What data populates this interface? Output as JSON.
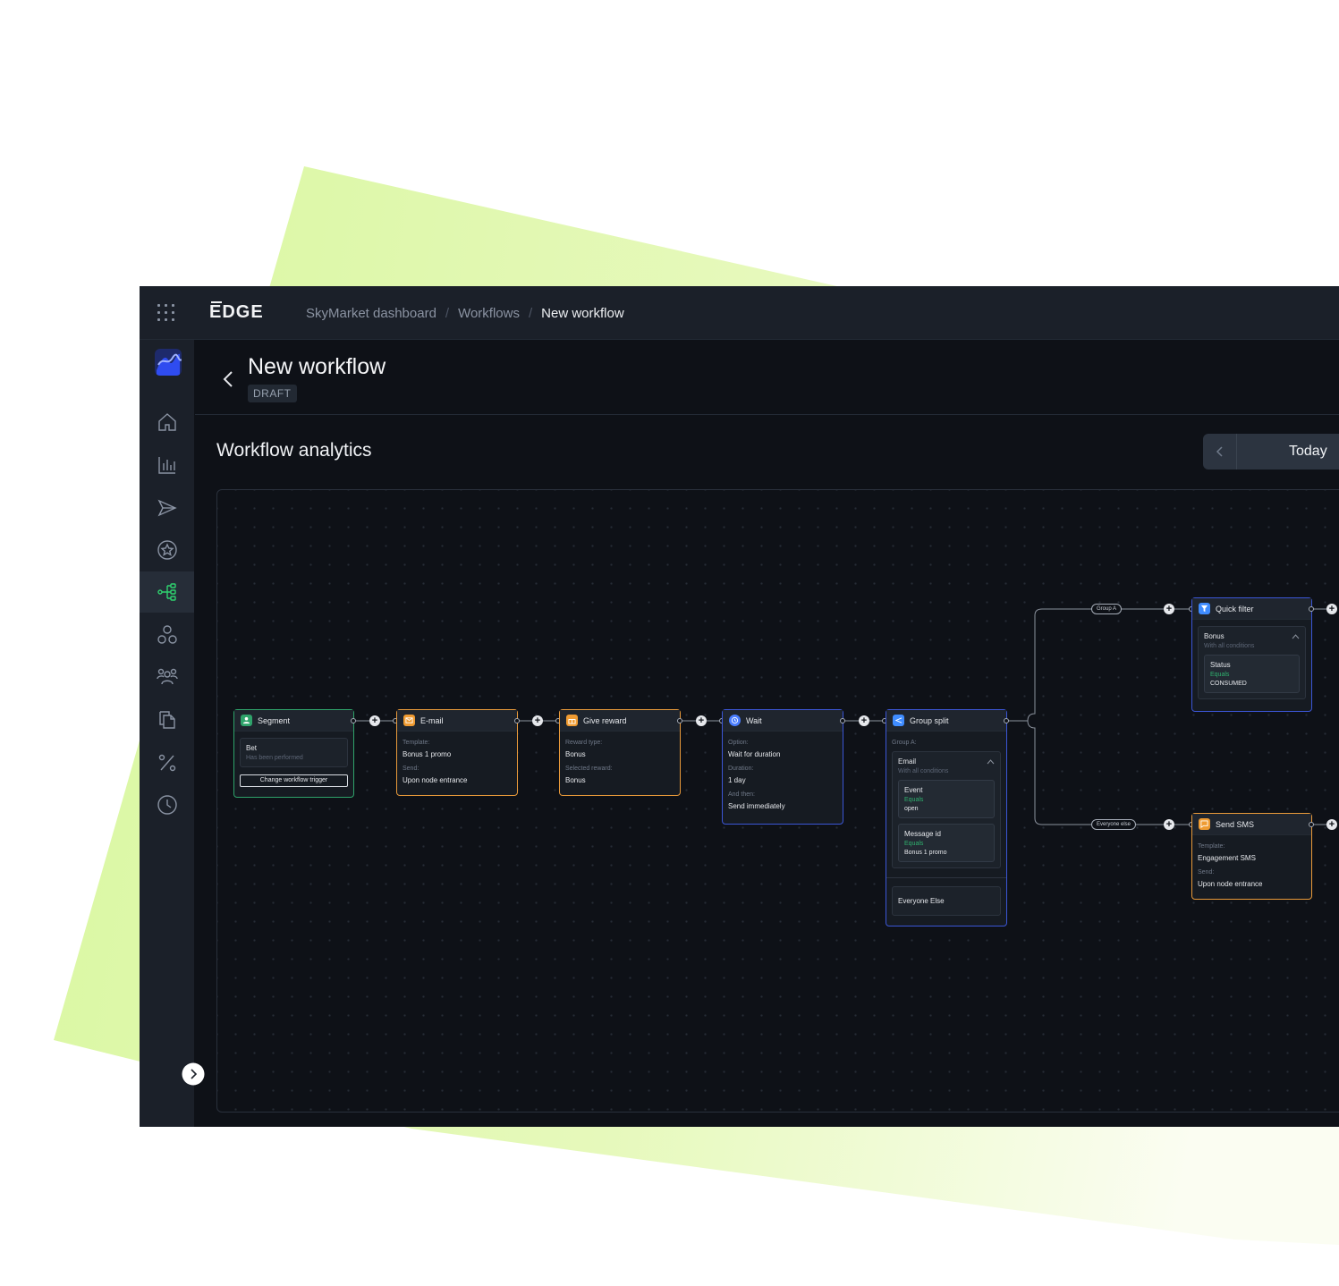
{
  "topbar": {
    "brand": "EDGE",
    "breadcrumb": [
      "SkyMarket dashboard",
      "Workflows",
      "New workflow"
    ]
  },
  "sidebar": {
    "items": [
      {
        "icon": "home-icon"
      },
      {
        "icon": "chart-icon"
      },
      {
        "icon": "send-icon"
      },
      {
        "icon": "star-badge-icon"
      },
      {
        "icon": "workflow-icon",
        "active": true
      },
      {
        "icon": "segments-icon"
      },
      {
        "icon": "users-icon"
      },
      {
        "icon": "documents-icon"
      },
      {
        "icon": "percent-icon"
      },
      {
        "icon": "clock-icon"
      }
    ],
    "accent": "#2fd36f"
  },
  "header": {
    "title": "New workflow",
    "status": "DRAFT"
  },
  "analytics": {
    "title": "Workflow analytics",
    "date_label": "Today"
  },
  "nodes": {
    "segment": {
      "title": "Segment",
      "condition": "Bet",
      "condition_hint": "Has been performed",
      "button": "Change workflow trigger"
    },
    "email": {
      "title": "E-mail",
      "template_label": "Template:",
      "template": "Bonus 1 promo",
      "send_label": "Send:",
      "send": "Upon node entrance"
    },
    "reward": {
      "title": "Give reward",
      "type_label": "Reward type:",
      "type": "Bonus",
      "selected_label": "Selected reward:",
      "selected": "Bonus"
    },
    "wait": {
      "title": "Wait",
      "option_label": "Option:",
      "option": "Wait for duration",
      "duration_label": "Duration:",
      "duration": "1 day",
      "then_label": "And then:",
      "then": "Send immediately"
    },
    "split": {
      "title": "Group split",
      "group_label": "Group A:",
      "channel": "Email",
      "channel_hint": "With all conditions",
      "cond1_name": "Event",
      "cond1_op": "Equals",
      "cond1_value": "open",
      "cond2_name": "Message id",
      "cond2_op": "Equals",
      "cond2_value": "Bonus 1 promo",
      "else": "Everyone Else"
    },
    "filter": {
      "title": "Quick filter",
      "group": "Bonus",
      "group_hint": "With all conditions",
      "cond_name": "Status",
      "cond_op": "Equals",
      "cond_value": "CONSUMED"
    },
    "sms": {
      "title": "Send SMS",
      "template_label": "Template:",
      "template": "Engagement SMS",
      "send_label": "Send:",
      "send": "Upon node entrance"
    }
  },
  "branches": {
    "group_a": "Group A",
    "everyone_else": "Everyone else"
  }
}
